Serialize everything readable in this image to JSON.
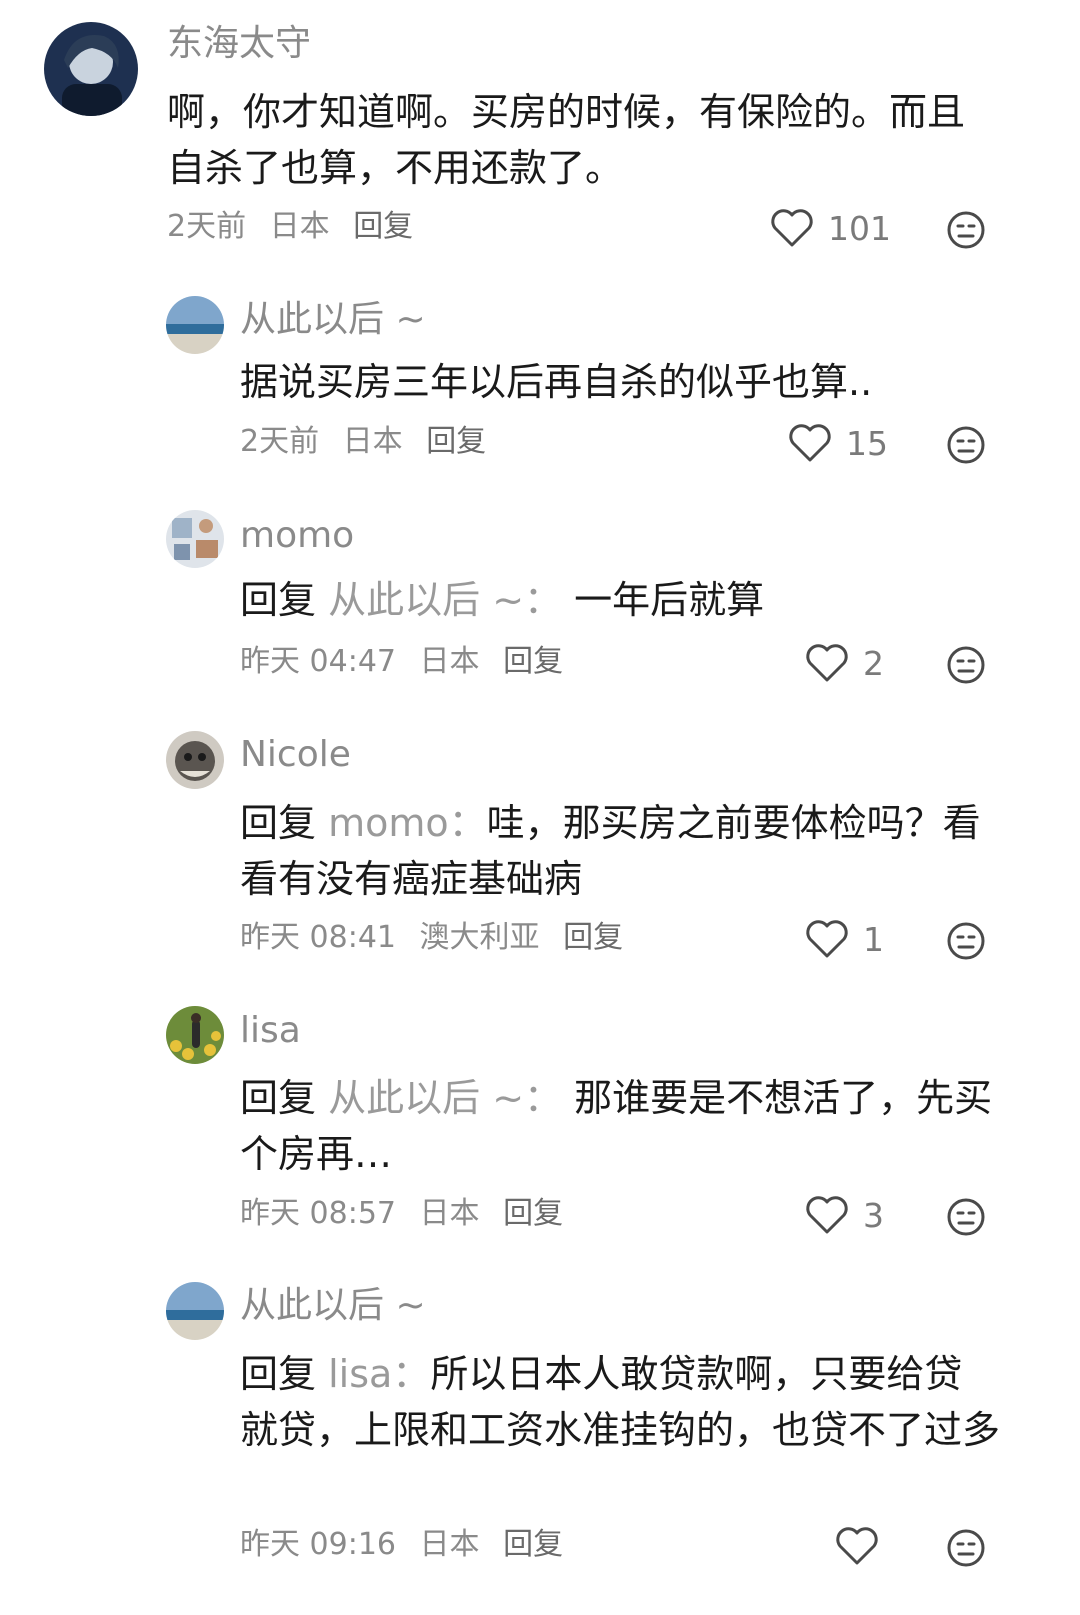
{
  "comments": [
    {
      "name": "东海太守",
      "body": "啊，你才知道啊。买房的时候，有保险的。而且自杀了也算，不用还款了。",
      "time": "2天前",
      "location": "日本",
      "reply": "回复",
      "likes": "101"
    },
    {
      "name": "从此以后 ~",
      "body": "据说买房三年以后再自杀的似乎也算..",
      "time": "2天前",
      "location": "日本",
      "reply": "回复",
      "likes": "15"
    },
    {
      "name": "momo",
      "reply_word": "回复",
      "reply_target": "从此以后 ~：",
      "body": "一年后就算",
      "time": "昨天 04:47",
      "location": "日本",
      "reply": "回复",
      "likes": "2"
    },
    {
      "name": "Nicole",
      "reply_word": "回复",
      "reply_target": "momo：",
      "body": "哇，那买房之前要体检吗？看看有没有癌症基础病",
      "time": "昨天 08:41",
      "location": "澳大利亚",
      "reply": "回复",
      "likes": "1"
    },
    {
      "name": "lisa",
      "reply_word": "回复",
      "reply_target": "从此以后 ~：",
      "body": "那谁要是不想活了，先买个房再…",
      "time": "昨天 08:57",
      "location": "日本",
      "reply": "回复",
      "likes": "3"
    },
    {
      "name": "从此以后 ~",
      "reply_word": "回复",
      "reply_target": "lisa：",
      "body": "所以日本人敢贷款啊，只要给贷就贷，上限和工资水准挂钩的，也贷不了过多",
      "time": "昨天 09:16",
      "location": "日本",
      "reply": "回复",
      "likes": ""
    }
  ]
}
